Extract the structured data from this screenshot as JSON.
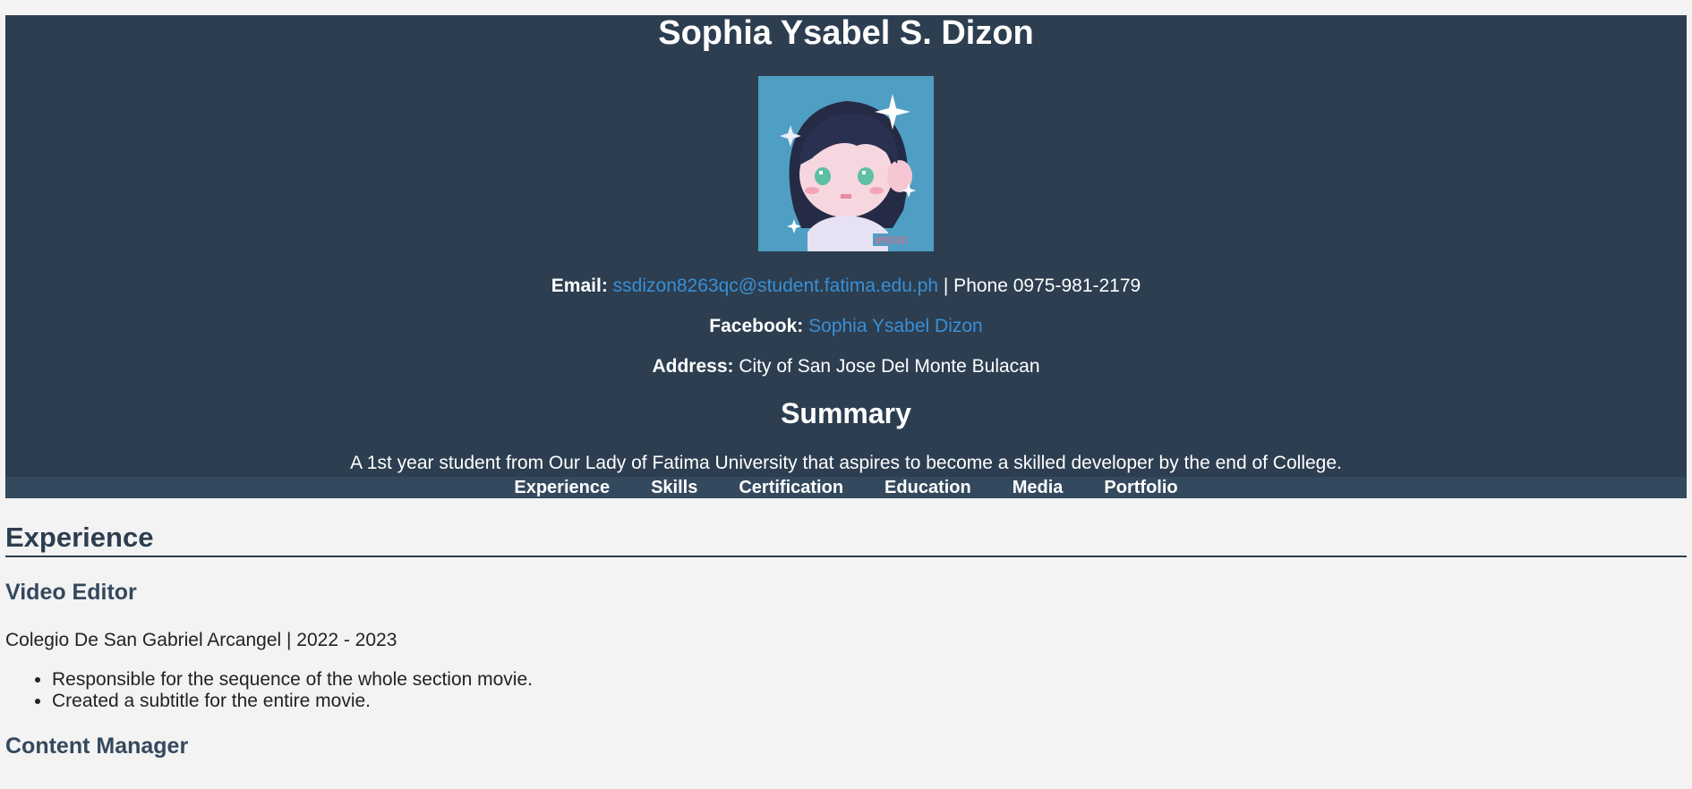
{
  "profile": {
    "name": "Sophia Ysabel S. Dizon",
    "avatar_alt": "pixel art avatar",
    "email_label": "Email:",
    "email": "ssdizon8263qc@student.fatima.edu.ph",
    "phone_sep": " | Phone 0975-981-2179",
    "facebook_label": "Facebook:",
    "facebook": "Sophia Ysabel Dizon",
    "address_label": "Address:",
    "address": "City of San Jose Del Monte Bulacan"
  },
  "summary": {
    "title": "Summary",
    "text": "A 1st year student from Our Lady of Fatima University that aspires to become a skilled developer by the end of College."
  },
  "nav": {
    "items": [
      "Experience",
      "Skills",
      "Certification",
      "Education",
      "Media",
      "Portfolio"
    ]
  },
  "experience": {
    "title": "Experience",
    "jobs": [
      {
        "title": "Video Editor",
        "meta": "Colegio De San Gabriel Arcangel | 2022 - 2023",
        "duties": [
          "Responsible for the sequence of the whole section movie.",
          "Created a subtitle for the entire movie."
        ]
      },
      {
        "title": "Content Manager"
      }
    ]
  },
  "colors": {
    "header_bg": "#2c3e50",
    "nav_bg": "#34495e",
    "link": "#3a8fd6",
    "page_bg": "#f3f3f3"
  }
}
